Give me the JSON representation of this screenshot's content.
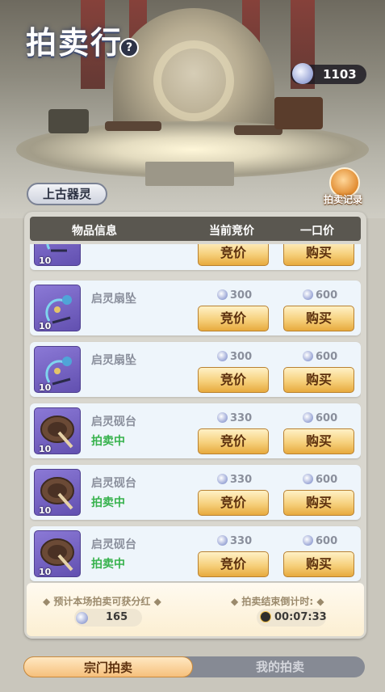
{
  "header": {
    "title": "拍卖行",
    "help_icon": "question-icon",
    "currency_value": "1103",
    "record_label": "拍卖记录"
  },
  "category_tag": "上古器灵",
  "table": {
    "col_info": "物品信息",
    "col_bid": "当前竞价",
    "col_buyout": "一口价"
  },
  "bid_label": "竞价",
  "buy_label": "购买",
  "partial_item": {
    "level": "10"
  },
  "items": [
    {
      "name": "启灵扇坠",
      "status": "",
      "level": "10",
      "bid": "300",
      "buyout": "600",
      "icon": "fan-pendant-icon"
    },
    {
      "name": "启灵扇坠",
      "status": "",
      "level": "10",
      "bid": "300",
      "buyout": "600",
      "icon": "fan-pendant-icon"
    },
    {
      "name": "启灵砚台",
      "status": "拍卖中",
      "level": "10",
      "bid": "330",
      "buyout": "600",
      "icon": "inkstone-icon"
    },
    {
      "name": "启灵砚台",
      "status": "拍卖中",
      "level": "10",
      "bid": "330",
      "buyout": "600",
      "icon": "inkstone-icon"
    },
    {
      "name": "启灵砚台",
      "status": "拍卖中",
      "level": "10",
      "bid": "330",
      "buyout": "600",
      "icon": "inkstone-icon"
    }
  ],
  "footer": {
    "dividend_label": "预计本场拍卖可获分红",
    "dividend_value": "165",
    "countdown_label": "拍卖结束倒计时:",
    "countdown_value": "00:07:33"
  },
  "tabs": [
    "宗门拍卖",
    "我的拍卖"
  ],
  "colors": {
    "accent_gold": "#f6d07c",
    "status_green": "#37b24d",
    "item_purple": "#6250b0"
  }
}
